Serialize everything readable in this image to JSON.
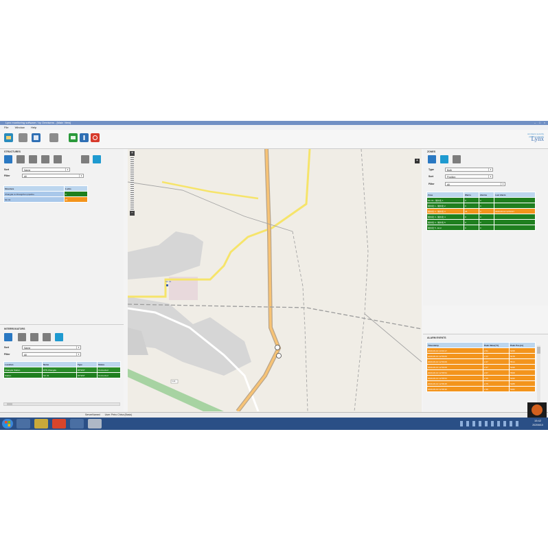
{
  "window": {
    "title": "Lynx monitoring software / by Omnisens - [Main View]",
    "controls": [
      "–",
      "□",
      "×"
    ]
  },
  "menu": [
    "File",
    "Window",
    "Help"
  ],
  "brand": {
    "line1": "omnisens security",
    "line2": "pipeline integrity",
    "logo": "Lynx"
  },
  "structures": {
    "title": "STRUCTURES",
    "sort_label": "Sort",
    "sort_value": "Name",
    "filter_label": "Filter",
    "filter_value": "All",
    "headers": [
      "Structure",
      "Locks"
    ],
    "rows": [
      {
        "name": "Changde to Changchun pipeline",
        "value": "0"
      },
      {
        "name": "SC 01",
        "value": "20"
      }
    ]
  },
  "interrogators": {
    "title": "INTERROGATORS",
    "sort_label": "Sort",
    "sort_value": "Name",
    "filter_label": "Filter",
    "filter_value": "All",
    "headers": [
      "Location",
      "Name",
      "Type",
      "Status"
    ],
    "rows": [
      {
        "location": "Changde Station",
        "name": "DTS Changde",
        "type": "DITEST",
        "status": "Connected"
      },
      {
        "location": "Station",
        "name": "SC 01",
        "type": "DITEST",
        "status": "Connected"
      }
    ]
  },
  "zones": {
    "title": "ZONES",
    "type_label": "Type",
    "type_value": "Both",
    "sort_label": "Sort",
    "sort_value": "Position",
    "filter_label": "Filter",
    "filter_value": "All",
    "headers": [
      "Zone",
      "Warns",
      "Alarms",
      "Last Alarm"
    ],
    "rows": [
      {
        "zone": "SC 01 - 常州北 1",
        "warns": "0",
        "alarms": "0",
        "last": "",
        "state": "green"
      },
      {
        "zone": "常州北 1 - 常州北 2",
        "warns": "0",
        "alarms": "0",
        "last": "",
        "state": "green"
      },
      {
        "zone": "常州北 2 - 常州北 3",
        "warns": "25",
        "alarms": "0",
        "last": "2020-06-10 12:53:07",
        "state": "orange"
      },
      {
        "zone": "常州北 3 - 常州北 4",
        "warns": "0",
        "alarms": "0",
        "last": "",
        "state": "green"
      },
      {
        "zone": "常州北 4 - 常州北 5",
        "warns": "0",
        "alarms": "0",
        "last": "",
        "state": "green"
      },
      {
        "zone": "常州北 5 - End",
        "warns": "0",
        "alarms": "0",
        "last": "",
        "state": "green"
      }
    ]
  },
  "alarm_events": {
    "title": "ALARM EVENTS",
    "headers": [
      "Timestamp",
      "Peak Value[°C]",
      "Peak Pos.[m]"
    ],
    "rows": [
      {
        "ts": "2020-06-10 13:00:17",
        "peak": "2.51",
        "pos": "5458"
      },
      {
        "ts": "2020-06-10 12:59:09",
        "peak": "2.22",
        "pos": "5478"
      },
      {
        "ts": "2020-06-10 12:59:09",
        "peak": "2.47",
        "pos": "5514"
      },
      {
        "ts": "2020-06-10 12:59:09",
        "peak": "2.37",
        "pos": "5498"
      },
      {
        "ts": "2020-06-10 12:58:54",
        "peak": "2.67",
        "pos": "5508"
      },
      {
        "ts": "2020-06-10 12:58:54",
        "peak": "2.36",
        "pos": "5490"
      },
      {
        "ts": "2020-06-10 12:58:45",
        "peak": "2.75",
        "pos": "5488"
      },
      {
        "ts": "2020-06-10 12:58:36",
        "peak": "2.39",
        "pos": "5482"
      }
    ]
  },
  "map": {
    "position_text": "Position (Lon | Lat): 126.9645441 | 45.2895821",
    "road_label": "G11",
    "marker_label": "SC 01"
  },
  "status": {
    "server": "ServerNamed",
    "user": "User: Petro China (Basic)"
  },
  "taskbar": {
    "time": "15:42",
    "date": "2020/6/10"
  },
  "colors": {
    "ok_green": "#1f7f1f",
    "warn_orange": "#f3941c",
    "header_blue": "#bcd6ee",
    "title_bar": "#6f8fc4"
  }
}
